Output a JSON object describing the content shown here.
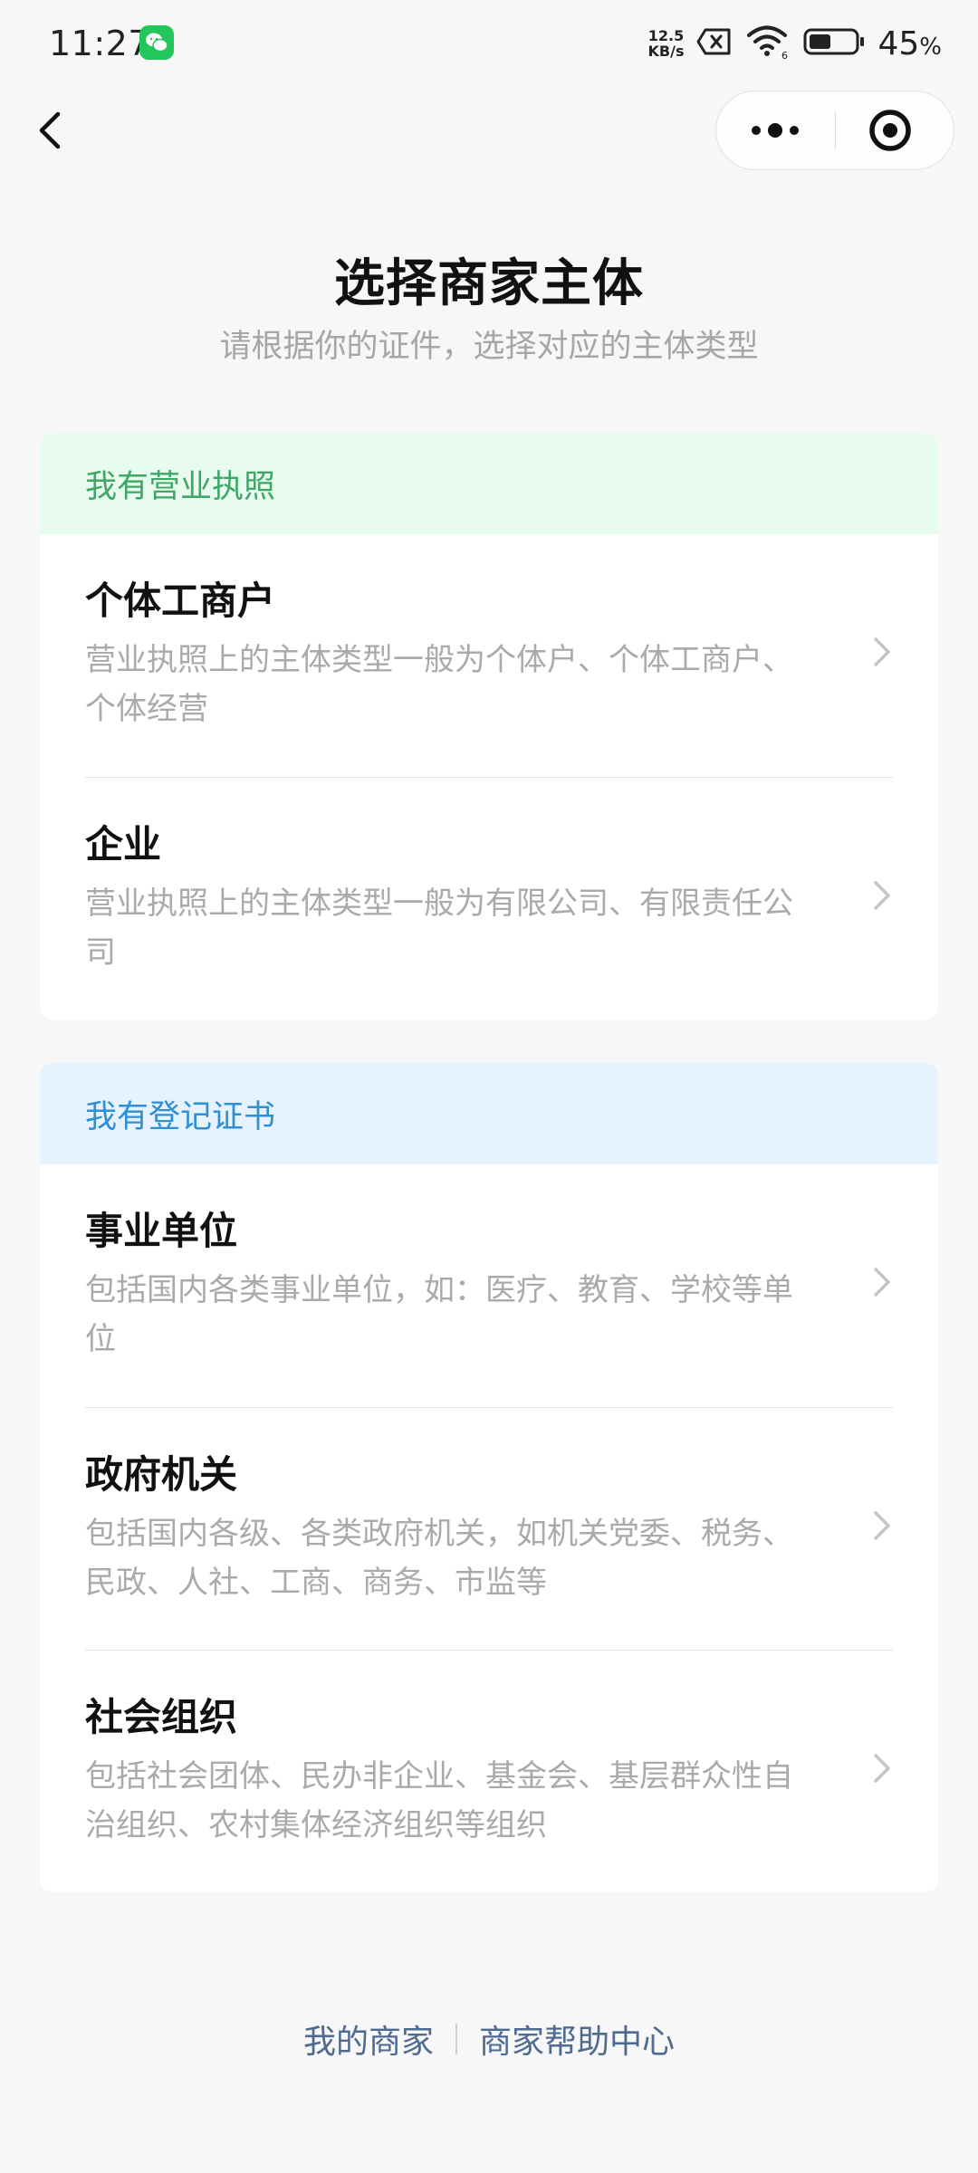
{
  "status_bar": {
    "time": "11:27",
    "net_speed_value": "12.5",
    "net_speed_unit": "KB/s",
    "battery_percent": "45",
    "battery_level": 0.45,
    "battery_unit": "%"
  },
  "page": {
    "title": "选择商家主体",
    "subtitle": "请根据你的证件，选择对应的主体类型"
  },
  "sections": [
    {
      "header": "我有营业执照",
      "accent_color": "#3fa766",
      "header_bg": "#e8fbef",
      "options": [
        {
          "title": "个体工商户",
          "desc_line1": "营业执照上的主体类型一般为个体户、个体工商户、",
          "desc_line2": "个体经营"
        },
        {
          "title": "企业",
          "desc_line1": "营业执照上的主体类型一般为有限公司、有限责任公",
          "desc_line2": "司"
        }
      ]
    },
    {
      "header": "我有登记证书",
      "accent_color": "#2d8fd6",
      "header_bg": "#e6f2fd",
      "options": [
        {
          "title": "事业单位",
          "desc_line1": "包括国内各类事业单位，如：医疗、教育、学校等单",
          "desc_line2": "位"
        },
        {
          "title": "政府机关",
          "desc_line1": "包括国内各级、各类政府机关，如机关党委、税务、",
          "desc_line2": "民政、人社、工商、商务、市监等"
        },
        {
          "title": "社会组织",
          "desc_line1": "包括社会团体、民办非企业、基金会、基层群众性自",
          "desc_line2": "治组织、农村集体经济组织等组织"
        }
      ]
    }
  ],
  "footer": {
    "my_merchant": "我的商家",
    "help_center": "商家帮助中心",
    "link_color": "#4e6a90"
  },
  "icons": {
    "back": "chevron-left-icon",
    "more": "more-dots-icon",
    "close": "target-close-icon",
    "option_arrow": "chevron-right-icon"
  }
}
